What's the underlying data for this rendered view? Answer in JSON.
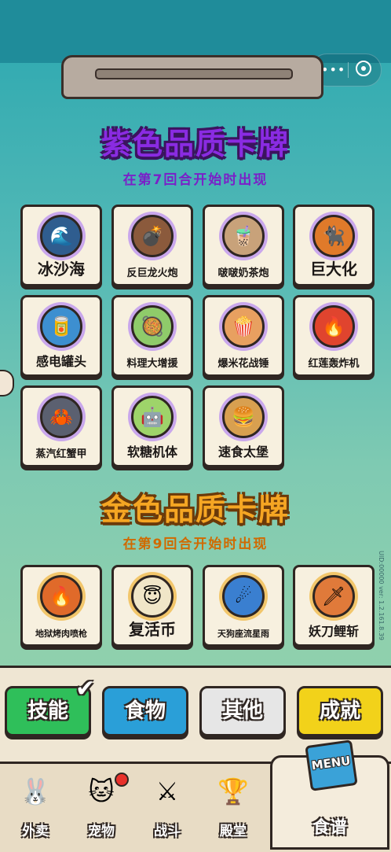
{
  "header": {
    "capsule_more": "•••",
    "capsule_close_icon": "target-circle-icon"
  },
  "purple_section": {
    "title": "紫色品质卡牌",
    "subtitle": "在第7回合开始时出现",
    "cards": [
      {
        "label": "冰沙海",
        "icon": "wave-icon",
        "glyph": "🌊",
        "bg": "#2f5d8f"
      },
      {
        "label": "反巨龙火炮",
        "icon": "cannon-icon",
        "glyph": "💣",
        "bg": "#8b5a3c"
      },
      {
        "label": "啵啵奶茶炮",
        "icon": "milktea-cannon-icon",
        "glyph": "🧋",
        "bg": "#c8a27a"
      },
      {
        "label": "巨大化",
        "icon": "giant-cat-icon",
        "glyph": "🐈‍⬛",
        "bg": "#e07a2a"
      },
      {
        "label": "感电罐头",
        "icon": "battery-can-icon",
        "glyph": "🥫",
        "bg": "#3d8fd0"
      },
      {
        "label": "料理大增援",
        "icon": "cooking-icon",
        "glyph": "🥘",
        "bg": "#8fcb6a"
      },
      {
        "label": "爆米花战锤",
        "icon": "popcorn-hammer-icon",
        "glyph": "🍿",
        "bg": "#e8a060"
      },
      {
        "label": "红莲轰炸机",
        "icon": "bomber-icon",
        "glyph": "🔥",
        "bg": "#e0442e"
      },
      {
        "label": "蒸汽红蟹甲",
        "icon": "crab-armor-icon",
        "glyph": "🦀",
        "bg": "#5b6070"
      },
      {
        "label": "软糖机体",
        "icon": "gummy-robot-icon",
        "glyph": "🤖",
        "bg": "#9ed46a"
      },
      {
        "label": "速食太堡",
        "icon": "burger-icon",
        "glyph": "🍔",
        "bg": "#d8a050"
      }
    ]
  },
  "gold_section": {
    "title": "金色品质卡牌",
    "subtitle": "在第9回合开始时出现",
    "cards": [
      {
        "label": "地狱烤肉喷枪",
        "icon": "flamethrower-icon",
        "glyph": "🔥",
        "bg": "#e06a2a"
      },
      {
        "label": "复活币",
        "icon": "angel-cat-coin-icon",
        "glyph": "😇",
        "bg": "#f0e6c8"
      },
      {
        "label": "天狗座流星雨",
        "icon": "meteor-icon",
        "glyph": "☄",
        "bg": "#3a7fd0"
      },
      {
        "label": "妖刀鲤斩",
        "icon": "katana-icon",
        "glyph": "🗡",
        "bg": "#e07a3a"
      }
    ]
  },
  "category_tabs": [
    {
      "label": "技能",
      "bg": "#2fbf5a",
      "checked": true
    },
    {
      "label": "食物",
      "bg": "#2a9fd8",
      "checked": false
    },
    {
      "label": "其他",
      "bg": "#e6e6e6",
      "checked": false
    },
    {
      "label": "成就",
      "bg": "#f2d21a",
      "checked": false
    }
  ],
  "bottom_nav": [
    {
      "label": "外卖",
      "icon": "bunny-delivery-icon",
      "glyph": "🐰"
    },
    {
      "label": "宠物",
      "icon": "pet-cat-icon",
      "glyph": "🐱"
    },
    {
      "label": "战斗",
      "icon": "battle-vs-icon",
      "glyph": "⚔"
    },
    {
      "label": "殿堂",
      "icon": "trophy-icon",
      "glyph": "🏆"
    }
  ],
  "active_nav": {
    "label": "食谱",
    "badge_text": "MENU"
  },
  "version_text": "UID:00000 ver: 1.2.161.8.39",
  "colors": {
    "purple": "#8a2be2",
    "gold": "#f5a623",
    "outline": "#2f2622"
  }
}
